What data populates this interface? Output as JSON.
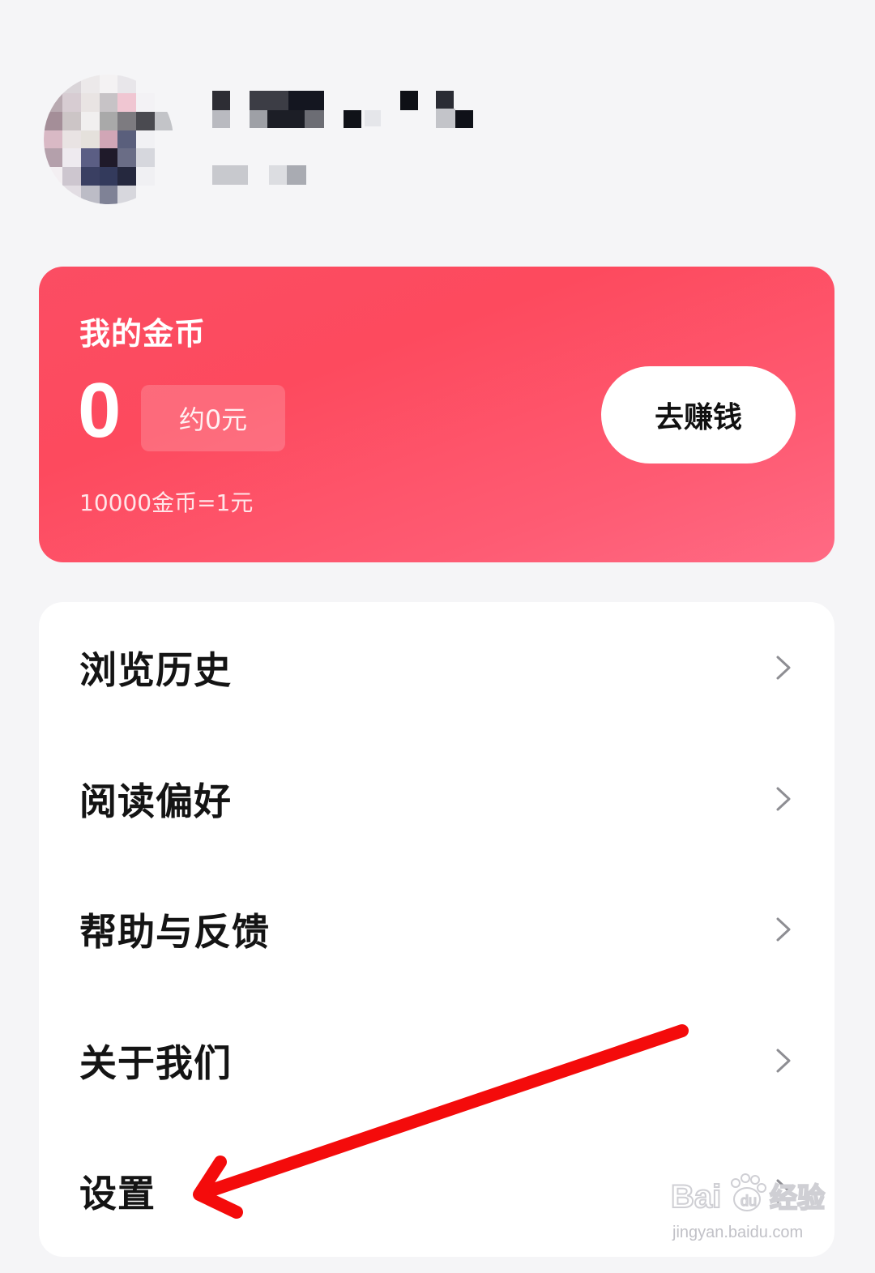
{
  "profile": {
    "avatar_icon": "avatar-icon",
    "name_hidden": true
  },
  "coin_card": {
    "title": "我的金币",
    "amount": "0",
    "yuan_equivalent": "约0元",
    "exchange_rate": "10000金币=1元",
    "earn_button_label": "去赚钱",
    "gradient_start": "#fb4d63",
    "gradient_end": "#ff6a84"
  },
  "menu": {
    "items": [
      {
        "label": "浏览历史",
        "icon": "chevron-right-icon"
      },
      {
        "label": "阅读偏好",
        "icon": "chevron-right-icon"
      },
      {
        "label": "帮助与反馈",
        "icon": "chevron-right-icon"
      },
      {
        "label": "关于我们",
        "icon": "chevron-right-icon"
      },
      {
        "label": "设置",
        "icon": "chevron-right-icon"
      }
    ]
  },
  "annotation": {
    "color": "#f40b0b",
    "target": "设置"
  },
  "watermark": {
    "logo_text": "Bai du 经验",
    "url": "jingyan.baidu.com"
  }
}
